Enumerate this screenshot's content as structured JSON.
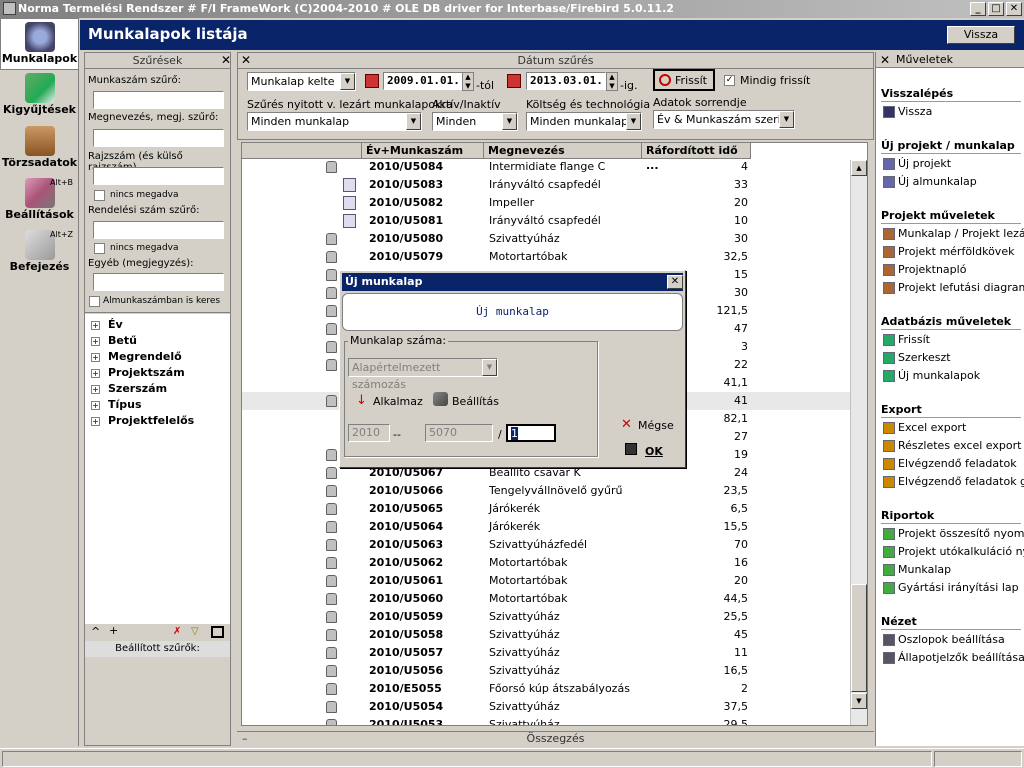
{
  "window": {
    "title": "Norma Termelési Rendszer # F/I FrameWork (C)2004-2010 # OLE DB driver for Interbase/Firebird 5.0.11.2",
    "min": "_",
    "max": "□",
    "close": "✕"
  },
  "nav": [
    {
      "label": "Munkalapok",
      "hotkey": ""
    },
    {
      "label": "Kigyűjtések",
      "hotkey": ""
    },
    {
      "label": "Törzsadatok",
      "hotkey": ""
    },
    {
      "label": "Beállítások",
      "hotkey": "Alt+B"
    },
    {
      "label": "Befejezés",
      "hotkey": "Alt+Z"
    }
  ],
  "header": {
    "title": "Munkalapok listája",
    "back_button": "Vissza"
  },
  "filters": {
    "panel_title": "Szűrések",
    "work_number_label": "Munkaszám szűrő:",
    "name_label": "Megnevezés, megj. szűrő:",
    "drawing_label": "Rajzszám (és külső rajzszám)",
    "not_given_1": "nincs megadva",
    "order_label": "Rendelési szám szűrő:",
    "not_given_2": "nincs megadva",
    "other_label": "Egyéb (megjegyzés):",
    "subwork_search": "Almunkaszámban is keres",
    "tree": [
      "Év",
      "Betű",
      "Megrendelő",
      "Projektszám",
      "Szerszám",
      "Típus",
      "Projektfelelős"
    ],
    "set_filters_label": "Beállított szűrők:",
    "toolbar_up": "^",
    "toolbar_plus": "+"
  },
  "date_filter": {
    "panel_title": "Dátum szűrés",
    "date_field": "Munkalap kelte",
    "from_date": "2009.01.01.",
    "from_suffix": "-tól",
    "to_date": "2013.03.01.",
    "to_suffix": "-ig.",
    "refresh_button": "Frissít",
    "always_refresh_label": "Mindig frissít",
    "open_closed_label": "Szűrés nyitott v. lezárt munkalapokra",
    "open_closed_value": "Minden munkalap",
    "active_label": "Aktív/Inaktív",
    "active_value": "Minden",
    "cost_label": "Költség és technológia",
    "cost_value": "Minden munkalap",
    "order_label": "Adatok sorrendje",
    "order_value": "Év & Munkaszám szerint"
  },
  "grid": {
    "columns": [
      "Év+Munkaszám",
      "Megnevezés",
      "Ráfordított idő ..."
    ],
    "rows": [
      {
        "code": "2010/U5084",
        "name": "Intermidiate flange C",
        "value": "4",
        "icon": "lock"
      },
      {
        "code": "2010/U5083",
        "name": "Irányváltó csapfedél",
        "value": "33",
        "icon": "doc"
      },
      {
        "code": "2010/U5082",
        "name": "Impeller",
        "value": "20",
        "icon": "doc"
      },
      {
        "code": "2010/U5081",
        "name": "Irányváltó csapfedél",
        "value": "10",
        "icon": "doc"
      },
      {
        "code": "2010/U5080",
        "name": "Szivattyúház",
        "value": "30",
        "icon": "lock"
      },
      {
        "code": "2010/U5079",
        "name": "Motortartóbak",
        "value": "32,5",
        "icon": "lock"
      },
      {
        "code": "",
        "name": "",
        "value": "15",
        "icon": "lock"
      },
      {
        "code": "",
        "name": "",
        "value": "30",
        "icon": "lock"
      },
      {
        "code": "",
        "name": "",
        "value": "121,5",
        "icon": "lock"
      },
      {
        "code": "",
        "name": "",
        "value": "47",
        "icon": "lock"
      },
      {
        "code": "",
        "name": "",
        "value": "3",
        "icon": "lock"
      },
      {
        "code": "",
        "name": "",
        "value": "22",
        "icon": "lock"
      },
      {
        "code": "",
        "name": "",
        "value": "41,1",
        "icon": "none"
      },
      {
        "code": "",
        "name": "",
        "value": "41",
        "icon": "lock"
      },
      {
        "code": "",
        "name": "",
        "value": "82,1",
        "icon": "none"
      },
      {
        "code": "",
        "name": "",
        "value": "27",
        "icon": "none"
      },
      {
        "code": "",
        "name": "",
        "value": "19",
        "icon": "lock"
      },
      {
        "code": "2010/U5067",
        "name": "Beállító csavar K",
        "value": "24",
        "icon": "lock"
      },
      {
        "code": "2010/U5066",
        "name": "Tengelyvállnövelő gyűrű",
        "value": "23,5",
        "icon": "lock"
      },
      {
        "code": "2010/U5065",
        "name": "Járókerék",
        "value": "6,5",
        "icon": "lock"
      },
      {
        "code": "2010/U5064",
        "name": "Járókerék",
        "value": "15,5",
        "icon": "lock"
      },
      {
        "code": "2010/U5063",
        "name": "Szivattyúházfedél",
        "value": "70",
        "icon": "lock"
      },
      {
        "code": "2010/U5062",
        "name": "Motortartóbak",
        "value": "16",
        "icon": "lock"
      },
      {
        "code": "2010/U5061",
        "name": "Motortartóbak",
        "value": "20",
        "icon": "lock"
      },
      {
        "code": "2010/U5060",
        "name": "Motortartóbak",
        "value": "44,5",
        "icon": "lock"
      },
      {
        "code": "2010/U5059",
        "name": "Szivattyúház",
        "value": "25,5",
        "icon": "lock"
      },
      {
        "code": "2010/U5058",
        "name": "Szivattyúház",
        "value": "45",
        "icon": "lock"
      },
      {
        "code": "2010/U5057",
        "name": "Szivattyúház",
        "value": "11",
        "icon": "lock"
      },
      {
        "code": "2010/U5056",
        "name": "Szivattyúház",
        "value": "16,5",
        "icon": "lock"
      },
      {
        "code": "2010/E5055",
        "name": "Főorsó kúp átszabályozás",
        "value": "2",
        "icon": "lock"
      },
      {
        "code": "2010/U5054",
        "name": "Szivattyúház",
        "value": "37,5",
        "icon": "lock"
      },
      {
        "code": "2010/U5053",
        "name": "Szivattyúház",
        "value": "29,5",
        "icon": "lock"
      }
    ],
    "summary_label": "Összegzés",
    "summary_toggle": "–"
  },
  "actions": {
    "panel_title": "Műveletek",
    "sections": [
      {
        "title": "Visszalépés",
        "items": [
          "Vissza"
        ]
      },
      {
        "title": "Új projekt / munkalap",
        "items": [
          "Új projekt",
          "Új almunkalap"
        ]
      },
      {
        "title": "Projekt műveletek",
        "items": [
          "Munkalap / Projekt lezá",
          "Projekt mérföldkövek",
          "Projektnapló",
          "Projekt lefutási diagram"
        ]
      },
      {
        "title": "Adatbázis műveletek",
        "items": [
          "Frissít",
          "Szerkeszt",
          "Új munkalapok"
        ]
      },
      {
        "title": "Export",
        "items": [
          "Excel export",
          "Részletes excel export",
          "Elvégzendő feladatok",
          "Elvégzendő feladatok g"
        ]
      },
      {
        "title": "Riportok",
        "items": [
          "Projekt összesítő nyom",
          "Projekt utókalkuláció ny",
          "Munkalap",
          "Gyártási irányítási lap"
        ]
      },
      {
        "title": "Nézet",
        "items": [
          "Oszlopok beállítása",
          "Állapotjelzők beállítása"
        ]
      }
    ]
  },
  "dialog": {
    "title": "Új munkalap",
    "close": "✕",
    "banner": "Új munkalap",
    "group_label": "Munkalap száma:",
    "numbering_value": "Alapértelmezett számozás",
    "apply_label": "Alkalmaz",
    "settings_label": "Beállítás",
    "year_value": "2010",
    "dash": "--",
    "number_value": "5070",
    "slash": "/",
    "sub_value": "1",
    "cancel_button": "Mégse",
    "ok_button": "OK"
  }
}
